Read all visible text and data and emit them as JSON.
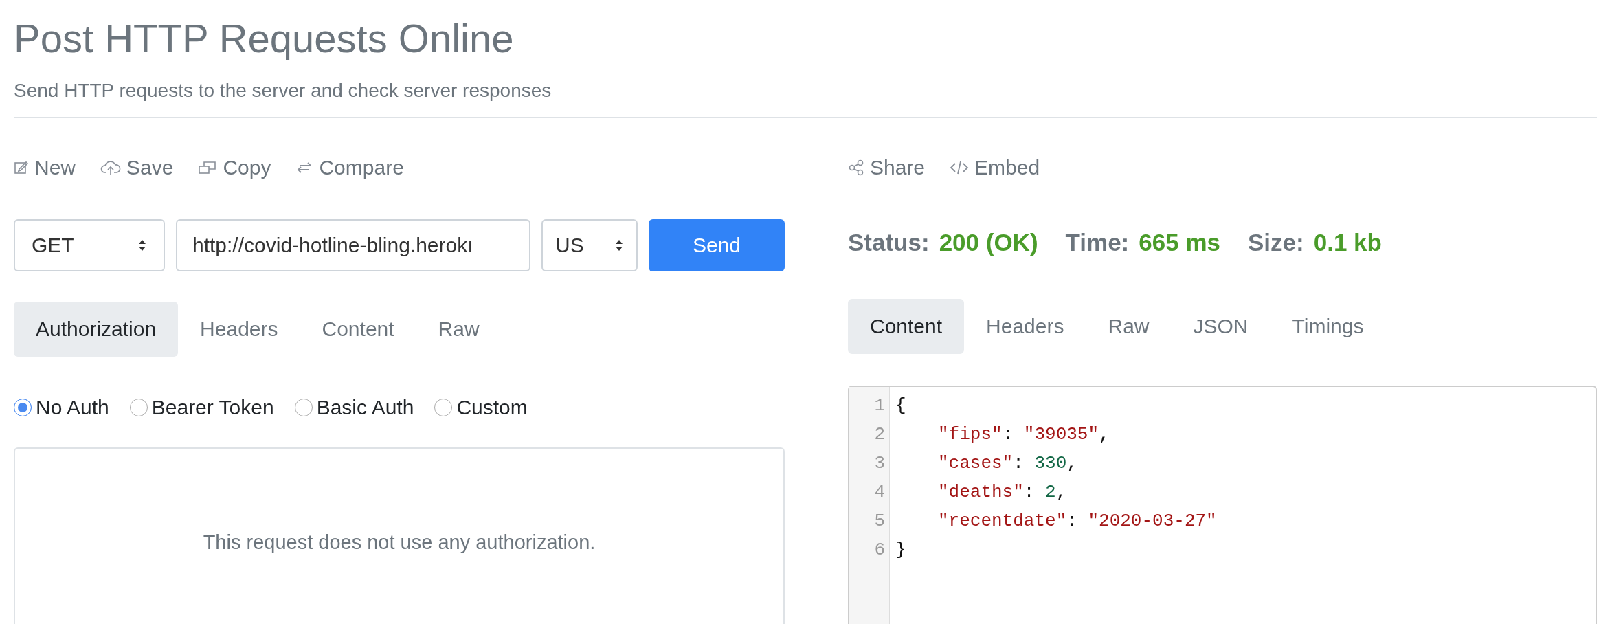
{
  "header": {
    "title": "Post HTTP Requests Online",
    "subtitle": "Send HTTP requests to the server and check server responses"
  },
  "request": {
    "toolbar": [
      {
        "kind": "new",
        "label": "New"
      },
      {
        "kind": "save",
        "label": "Save"
      },
      {
        "kind": "copy",
        "label": "Copy"
      },
      {
        "kind": "compare",
        "label": "Compare"
      }
    ],
    "method": "GET",
    "url": "http://covid-hotline-bling.herokı",
    "region": "US",
    "send": "Send",
    "tabs": [
      {
        "label": "Authorization",
        "selected": true
      },
      {
        "label": "Headers",
        "selected": false
      },
      {
        "label": "Content",
        "selected": false
      },
      {
        "label": "Raw",
        "selected": false
      }
    ],
    "auth_options": [
      {
        "label": "No Auth",
        "selected": true
      },
      {
        "label": "Bearer Token",
        "selected": false
      },
      {
        "label": "Basic Auth",
        "selected": false
      },
      {
        "label": "Custom",
        "selected": false
      }
    ],
    "auth_message": "This request does not use any authorization."
  },
  "response": {
    "toolbar": [
      {
        "kind": "share",
        "label": "Share"
      },
      {
        "kind": "embed",
        "label": "Embed"
      }
    ],
    "stats": [
      {
        "label": "Status:",
        "value": "200 (OK)"
      },
      {
        "label": "Time:",
        "value": "665 ms"
      },
      {
        "label": "Size:",
        "value": "0.1 kb"
      }
    ],
    "tabs": [
      {
        "label": "Content",
        "selected": true
      },
      {
        "label": "Headers",
        "selected": false
      },
      {
        "label": "Raw",
        "selected": false
      },
      {
        "label": "JSON",
        "selected": false
      },
      {
        "label": "Timings",
        "selected": false
      }
    ],
    "code_lines": [
      {
        "number": "1",
        "indented": false,
        "tokens": [
          {
            "kind": "punct",
            "text": "{"
          }
        ]
      },
      {
        "number": "2",
        "indented": true,
        "tokens": [
          {
            "kind": "key",
            "text": "\"fips\""
          },
          {
            "kind": "punct",
            "text": ": "
          },
          {
            "kind": "string",
            "text": "\"39035\""
          },
          {
            "kind": "punct",
            "text": ","
          }
        ]
      },
      {
        "number": "3",
        "indented": true,
        "tokens": [
          {
            "kind": "key",
            "text": "\"cases\""
          },
          {
            "kind": "punct",
            "text": ": "
          },
          {
            "kind": "number",
            "text": "330"
          },
          {
            "kind": "punct",
            "text": ","
          }
        ]
      },
      {
        "number": "4",
        "indented": true,
        "tokens": [
          {
            "kind": "key",
            "text": "\"deaths\""
          },
          {
            "kind": "punct",
            "text": ": "
          },
          {
            "kind": "number",
            "text": "2"
          },
          {
            "kind": "punct",
            "text": ","
          }
        ]
      },
      {
        "number": "5",
        "indented": true,
        "tokens": [
          {
            "kind": "key",
            "text": "\"recentdate\""
          },
          {
            "kind": "punct",
            "text": ": "
          },
          {
            "kind": "string",
            "text": "\"2020-03-27\""
          }
        ]
      },
      {
        "number": "6",
        "indented": false,
        "tokens": [
          {
            "kind": "punct",
            "text": "}"
          }
        ]
      }
    ]
  }
}
